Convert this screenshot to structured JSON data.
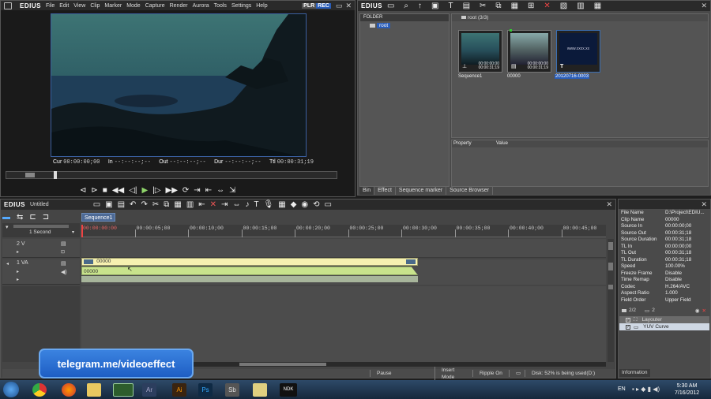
{
  "app": {
    "name": "EDIUS",
    "project_title": "Untitled"
  },
  "player": {
    "menu": [
      "File",
      "Edit",
      "View",
      "Clip",
      "Marker",
      "Mode",
      "Capture",
      "Render",
      "Aurora",
      "Tools",
      "Settings",
      "Help"
    ],
    "plr": "PLR",
    "rec": "REC",
    "timecodes": [
      {
        "label": "Cur",
        "value": "00:00:00;00"
      },
      {
        "label": "In",
        "value": "--:--:--;--"
      },
      {
        "label": "Out",
        "value": "--:--:--;--"
      },
      {
        "label": "Dur",
        "value": "--:--:--;--"
      },
      {
        "label": "Ttl",
        "value": "00:00:31;19"
      }
    ]
  },
  "bin": {
    "folder_header": "FOLDER",
    "root": "root",
    "path": "root (3/3)",
    "clips": [
      {
        "name": "Sequence1",
        "tc1": "00:00:00;00",
        "tc2": "00:00:31;19"
      },
      {
        "name": "00000",
        "tc1": "00:00:00;00",
        "tc2": "00:00:31;19"
      },
      {
        "name": "20120716-0003",
        "tc1": "www.xxxx.xx",
        "tc2": ""
      }
    ],
    "prop_header": "Property",
    "value_header": "Value",
    "tabs": [
      "Bin",
      "Effect",
      "Sequence marker",
      "Source Browser"
    ]
  },
  "timeline": {
    "sequence_tab": "Sequence1",
    "scale": "1 Second",
    "ruler": [
      "00:00:00:00",
      "00:00:05;00",
      "00:00:10;00",
      "00:00:15;00",
      "00:00:20;00",
      "00:00:25;00",
      "00:00:30;00",
      "00:00:35;00",
      "00:00:40;00",
      "00:00:45;00"
    ],
    "tracks": {
      "v": "2 V",
      "va": "1 VA"
    },
    "clip_video_label": "00000",
    "clip_audio_label": "00000"
  },
  "info_panel": {
    "rows": [
      [
        "File Name",
        "D:\\Project\\EDIU..."
      ],
      [
        "Clip Name",
        "00000"
      ],
      [
        "Source In",
        "00:00:00;00"
      ],
      [
        "Source Out",
        "00:00:31;18"
      ],
      [
        "Source Duration",
        "00:00:31;18"
      ],
      [
        "TL In",
        "00:00:00;00"
      ],
      [
        "TL Out",
        "00:00:31;18"
      ],
      [
        "TL Duration",
        "00:00:31;18"
      ],
      [
        "Speed",
        "100.00%"
      ],
      [
        "Freeze Frame",
        "Disable"
      ],
      [
        "Time Remap",
        "Disable"
      ],
      [
        "Codec",
        "H.264/AVC"
      ],
      [
        "Aspect Ratio",
        "1.000"
      ],
      [
        "Field Order",
        "Upper Field"
      ]
    ],
    "layer_count": "2/2",
    "layer_count2": "2",
    "layers": [
      "Layouter",
      "YUV Curve"
    ],
    "tab": "Information"
  },
  "status": {
    "pause": "Pause",
    "insert": "Insert Mode",
    "ripple": "Ripple On",
    "disk": "Disk: 52% is being used(D:)"
  },
  "overlay": {
    "text": "telegram.me/videoeffect"
  },
  "taskbar": {
    "lang": "EN",
    "time": "5:30 AM",
    "date": "7/16/2012",
    "icons": [
      "chrome-icon",
      "firefox-icon",
      "explorer-icon",
      "edius-icon",
      "ar-icon",
      "ai-icon",
      "ps-icon",
      "sb-icon",
      "app-icon",
      "ndk-icon"
    ],
    "labels": {
      "ar": "Ar",
      "ai": "Ai",
      "ps": "Ps",
      "sb": "Sb",
      "ndk": "NDK"
    }
  },
  "colors": {
    "accent_blue": "#3a6fb4",
    "clip_yellow": "#f6f1b0",
    "clip_green": "#c8e38c",
    "rec_blue": "#2a5db8"
  }
}
